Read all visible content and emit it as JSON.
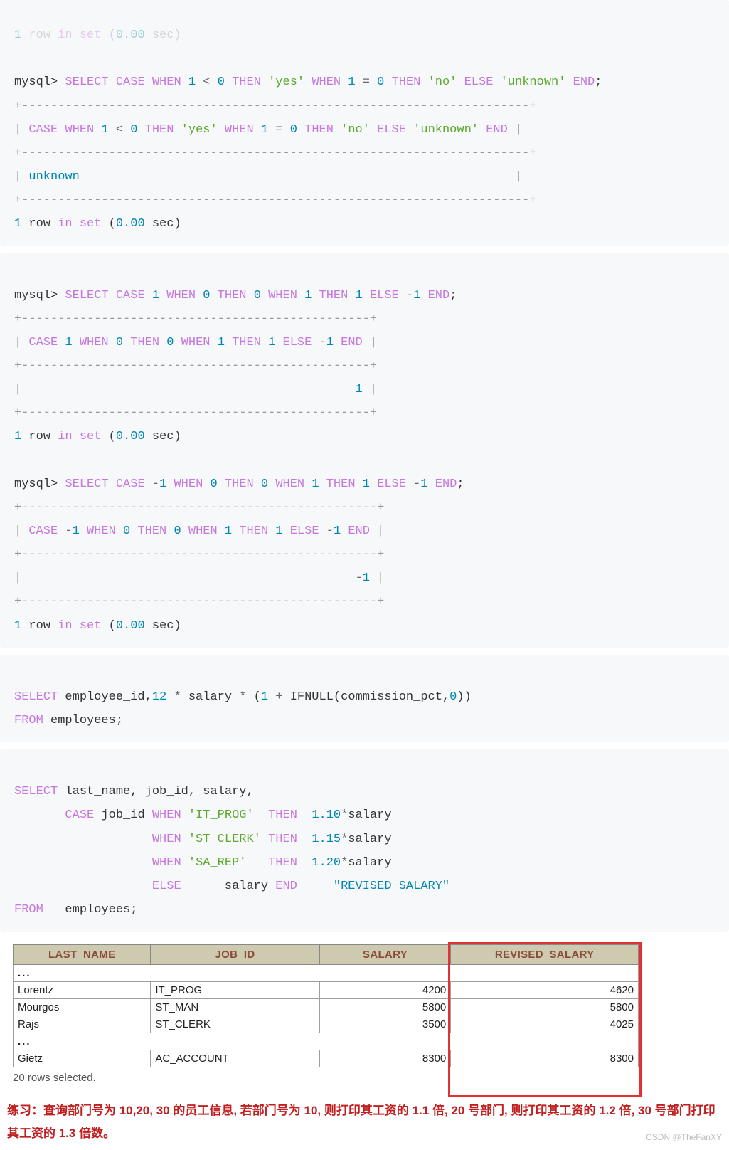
{
  "block1": {
    "truncated_top": "1 row in set (0.00 sec)",
    "prompt": "mysql> ",
    "sql": "SELECT CASE WHEN 1 < 0 THEN 'yes' WHEN 1 = 0 THEN 'no' ELSE 'unknown' END;",
    "border": "+----------------------------------------------------------------------+",
    "header": "| CASE WHEN 1 < 0 THEN 'yes' WHEN 1 = 0 THEN 'no' ELSE 'unknown' END |",
    "value_row": "| unknown                                                            |",
    "footer": "1 row in set (0.00 sec)"
  },
  "block2": {
    "prompt": "mysql> ",
    "sql1": "SELECT CASE 1 WHEN 0 THEN 0 WHEN 1 THEN 1 ELSE -1 END;",
    "border1": "+------------------------------------------------+",
    "header1": "| CASE 1 WHEN 0 THEN 0 WHEN 1 THEN 1 ELSE -1 END |",
    "value1": "|                                              1 |",
    "footer1": "1 row in set (0.00 sec)",
    "sql2": "SELECT CASE -1 WHEN 0 THEN 0 WHEN 1 THEN 1 ELSE -1 END;",
    "border2": "+-------------------------------------------------+",
    "header2": "| CASE -1 WHEN 0 THEN 0 WHEN 1 THEN 1 ELSE -1 END |",
    "value2": "|                                              -1 |",
    "footer2": "1 row in set (0.00 sec)"
  },
  "block3": {
    "line1": "SELECT employee_id,12 * salary * (1 + IFNULL(commission_pct,0))",
    "line2": "FROM employees;"
  },
  "block4": {
    "l1": "SELECT last_name, job_id, salary,",
    "l2": "       CASE job_id WHEN 'IT_PROG'  THEN  1.10*salary",
    "l3": "                   WHEN 'ST_CLERK' THEN  1.15*salary",
    "l4": "                   WHEN 'SA_REP'   THEN  1.20*salary",
    "l5": "                   ELSE      salary END     \"REVISED_SALARY\"",
    "l6": "FROM   employees;"
  },
  "table": {
    "headers": [
      "LAST_NAME",
      "JOB_ID",
      "SALARY",
      "REVISED_SALARY"
    ],
    "dots": "...",
    "rows": [
      {
        "last_name": "Lorentz",
        "job_id": "IT_PROG",
        "salary": "4200",
        "revised": "4620"
      },
      {
        "last_name": "Mourgos",
        "job_id": "ST_MAN",
        "salary": "5800",
        "revised": "5800"
      },
      {
        "last_name": "Rajs",
        "job_id": "ST_CLERK",
        "salary": "3500",
        "revised": "4025"
      }
    ],
    "last_row": {
      "last_name": "Gietz",
      "job_id": "AC_ACCOUNT",
      "salary": "8300",
      "revised": "8300"
    },
    "rows_note": "20 rows selected."
  },
  "exercise": {
    "text": "练习：查询部门号为 10,20, 30 的员工信息, 若部门号为 10, 则打印其工资的 1.1 倍, 20 号部门, 则打印其工资的 1.2 倍, 30 号部门打印其工资的 1.3 倍数。",
    "watermark": "CSDN @TheFanXY"
  }
}
